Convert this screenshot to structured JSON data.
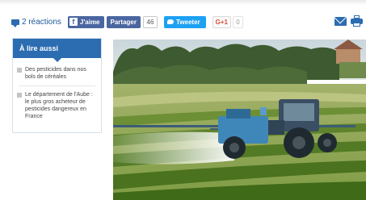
{
  "share": {
    "reactions_label": "2 réactions",
    "facebook_like_label": "J'aime",
    "facebook_share_label": "Partager",
    "facebook_count": "46",
    "twitter_label": "Tweeter",
    "gplus_label": "G+1",
    "gplus_count": "0"
  },
  "related": {
    "title": "À lire aussi",
    "items": [
      {
        "label": "Des pesticides dans nos bols de céréales"
      },
      {
        "label": "Le département de l'Aube : le plus gros acheteur de pesticides dangereux en France"
      }
    ]
  },
  "colors": {
    "accent": "#2c6cb0",
    "facebook": "#4a66a0",
    "twitter": "#1da1f2",
    "gplus": "#dd4b39"
  },
  "icons": [
    "comment-icon",
    "facebook-icon",
    "twitter-icon",
    "mail-icon",
    "print-icon"
  ]
}
